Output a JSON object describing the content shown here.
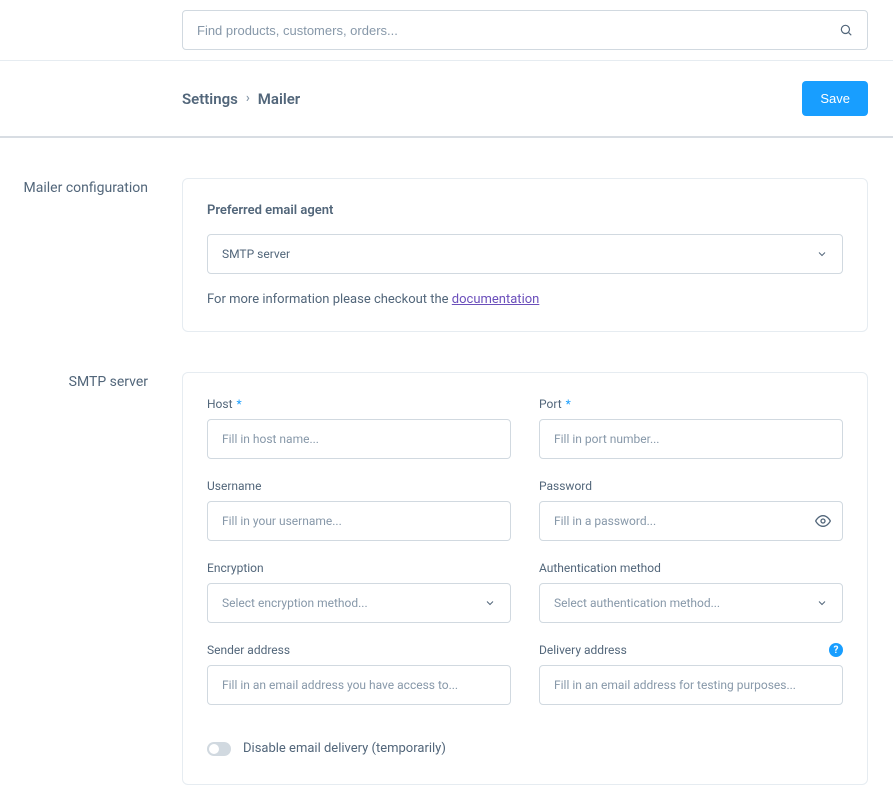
{
  "search": {
    "placeholder": "Find products, customers, orders..."
  },
  "breadcrumb": {
    "parent": "Settings",
    "current": "Mailer"
  },
  "actions": {
    "save": "Save"
  },
  "sections": {
    "mailer_config": {
      "title": "Mailer configuration",
      "agent_label": "Preferred email agent",
      "agent_value": "SMTP server",
      "helper_prefix": "For more information please checkout the ",
      "helper_link": "documentation"
    },
    "smtp": {
      "title": "SMTP server",
      "host": {
        "label": "Host",
        "placeholder": "Fill in host name..."
      },
      "port": {
        "label": "Port",
        "placeholder": "Fill in port number..."
      },
      "username": {
        "label": "Username",
        "placeholder": "Fill in your username..."
      },
      "password": {
        "label": "Password",
        "placeholder": "Fill in a password..."
      },
      "encryption": {
        "label": "Encryption",
        "placeholder": "Select encryption method..."
      },
      "auth": {
        "label": "Authentication method",
        "placeholder": "Select authentication method..."
      },
      "sender": {
        "label": "Sender address",
        "placeholder": "Fill in an email address you have access to..."
      },
      "delivery": {
        "label": "Delivery address",
        "placeholder": "Fill in an email address for testing purposes..."
      },
      "disable_toggle": "Disable email delivery (temporarily)"
    }
  }
}
